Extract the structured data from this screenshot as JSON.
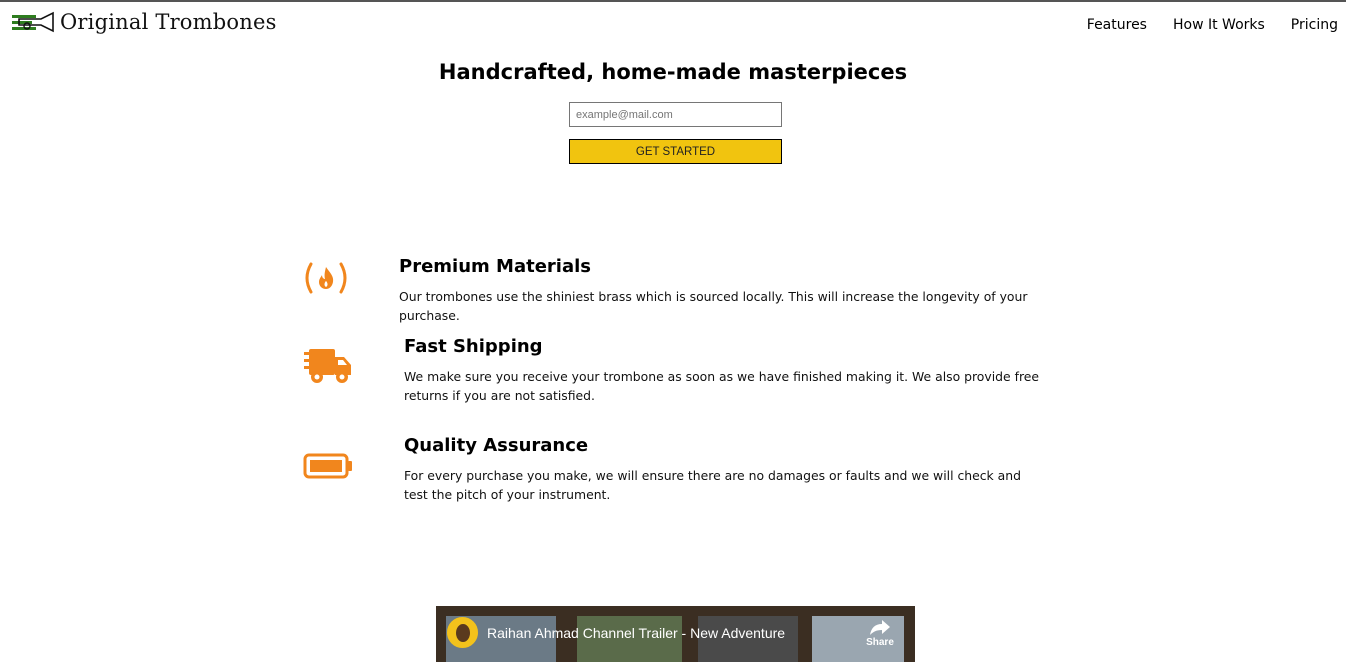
{
  "header": {
    "brand": "Original Trombones",
    "nav": [
      "Features",
      "How It Works",
      "Pricing"
    ]
  },
  "hero": {
    "title": "Handcrafted, home-made masterpieces",
    "email_placeholder": "example@mail.com",
    "cta_label": "GET STARTED"
  },
  "features": [
    {
      "icon": "fire-icon",
      "title": "Premium Materials",
      "text": "Our trombones use the shiniest brass which is sourced locally. This will increase the longevity of your purchase."
    },
    {
      "icon": "truck-icon",
      "title": "Fast Shipping",
      "text": "We make sure you receive your trombone as soon as we have finished making it. We also provide free returns if you are not satisfied."
    },
    {
      "icon": "battery-icon",
      "title": "Quality Assurance",
      "text": "For every purchase you make, we will ensure there are no damages or faults and we will check and test the pitch of your instrument."
    }
  ],
  "video": {
    "title": "Raihan Ahmad Channel Trailer - New Adventure",
    "share_label": "Share"
  },
  "colors": {
    "accent": "#f1c40f",
    "icon": "#f1861d",
    "logo_green": "#2e7d1f"
  }
}
